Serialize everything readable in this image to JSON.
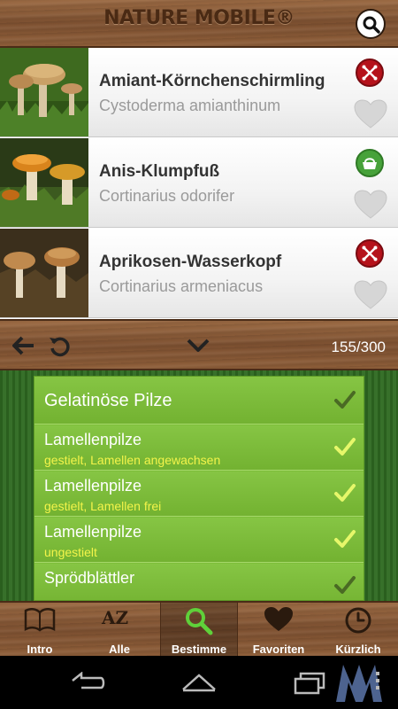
{
  "header": {
    "logo_text": "NATURE MOBILE®",
    "search_icon": "search-icon"
  },
  "species": [
    {
      "name": "Amiant-Körnchenschirmling",
      "latin": "Cystoderma amianthinum",
      "status": "toxic",
      "status_icon": "toxic-x-icon"
    },
    {
      "name": "Anis-Klumpfuß",
      "latin": "Cortinarius odorifer",
      "status": "edible",
      "status_icon": "basket-icon"
    },
    {
      "name": "Aprikosen-Wasserkopf",
      "latin": "Cortinarius armeniacus",
      "status": "toxic",
      "status_icon": "toxic-x-icon"
    }
  ],
  "toolbar": {
    "counter": "155/300"
  },
  "filters": [
    {
      "title": "Gelatinöse Pilze",
      "subtitle": "",
      "checked": false
    },
    {
      "title": "Lamellenpilze",
      "subtitle": "gestielt, Lamellen angewachsen",
      "checked": true
    },
    {
      "title": "Lamellenpilze",
      "subtitle": "gestielt, Lamellen frei",
      "checked": true
    },
    {
      "title": "Lamellenpilze",
      "subtitle": "ungestielt",
      "checked": true
    },
    {
      "title": "Sprödblättler",
      "subtitle": "",
      "checked": false
    }
  ],
  "nav": [
    {
      "label": "Intro",
      "icon": "book-icon",
      "active": false
    },
    {
      "label": "Alle",
      "icon": "az-sort-icon",
      "active": false
    },
    {
      "label": "Bestimme",
      "icon": "magnifier-icon",
      "active": true
    },
    {
      "label": "Favoriten",
      "icon": "heart-icon",
      "active": false
    },
    {
      "label": "Kürzlich",
      "icon": "clock-icon",
      "active": false
    }
  ],
  "nav_az_glyph": "AZ",
  "colors": {
    "wood": "#8a5a35",
    "filter_green": "#7dbe3a",
    "subtitle_yellow": "#f3f44a",
    "toxic_red": "#b5121b",
    "edible_green": "#47a23a"
  }
}
